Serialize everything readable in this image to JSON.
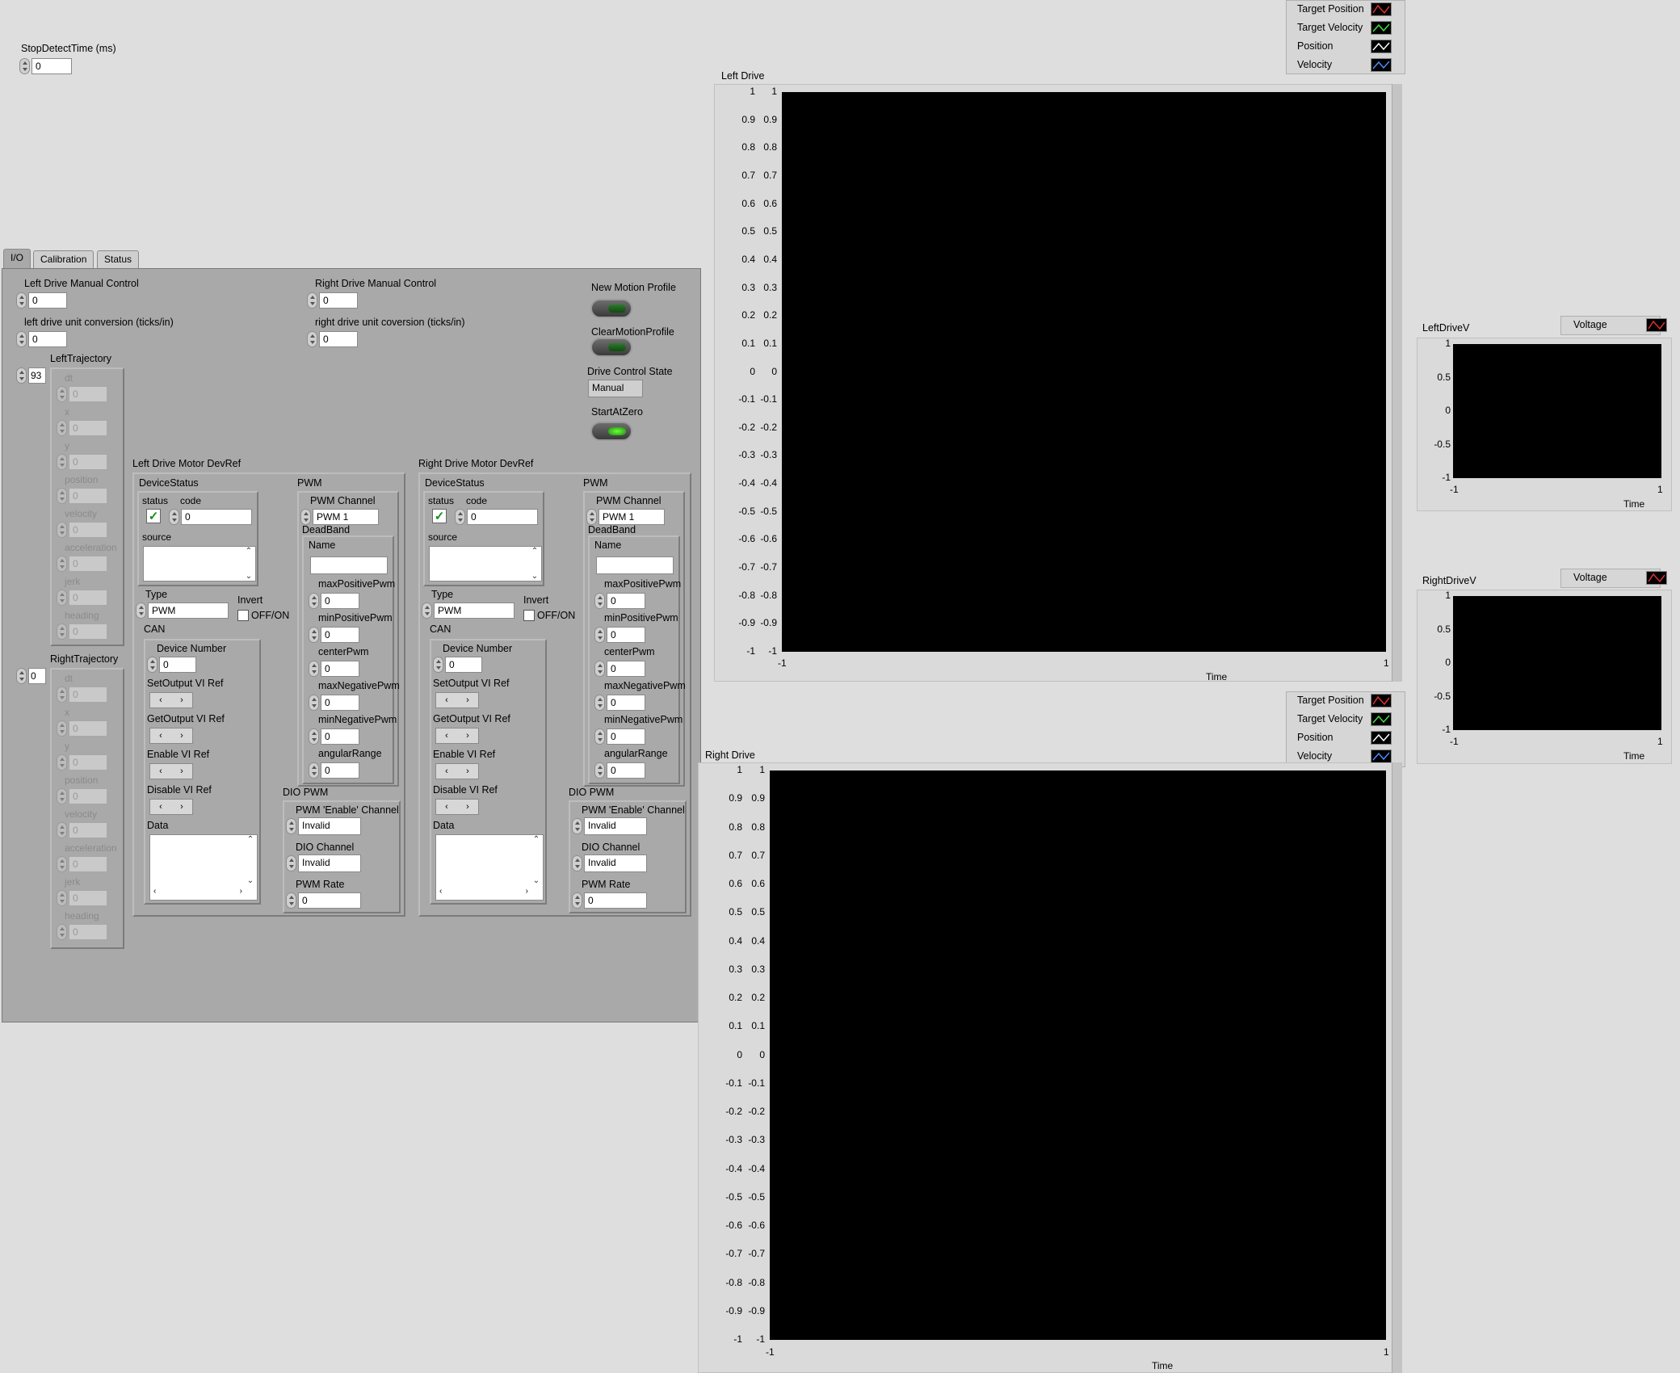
{
  "stop_detect": {
    "label": "StopDetectTime (ms)",
    "value": "0"
  },
  "tabs": [
    {
      "label": "I/O",
      "active": true
    },
    {
      "label": "Calibration",
      "active": false
    },
    {
      "label": "Status",
      "active": false
    }
  ],
  "io": {
    "left_manual": {
      "label": "Left Drive Manual Control",
      "value": "0"
    },
    "left_conv": {
      "label": "left drive unit conversion (ticks/in)",
      "value": "0"
    },
    "right_manual": {
      "label": "Right Drive Manual Control",
      "value": "0"
    },
    "right_conv": {
      "label": "right drive unit coversion (ticks/in)",
      "value": "0"
    },
    "new_motion_profile": "New Motion Profile",
    "clear_motion_profile": "ClearMotionProfile",
    "drive_control_state": {
      "label": "Drive Control State",
      "value": "Manual"
    },
    "start_at_zero": "StartAtZero",
    "left_traj": {
      "label": "LeftTrajectory",
      "index": "93",
      "fields": [
        {
          "label": "dt",
          "value": "0"
        },
        {
          "label": "x",
          "value": "0"
        },
        {
          "label": "y",
          "value": "0"
        },
        {
          "label": "position",
          "value": "0"
        },
        {
          "label": "velocity",
          "value": "0"
        },
        {
          "label": "acceleration",
          "value": "0"
        },
        {
          "label": "jerk",
          "value": "0"
        },
        {
          "label": "heading",
          "value": "0"
        }
      ]
    },
    "right_traj": {
      "label": "RightTrajectory",
      "index": "0",
      "fields": [
        {
          "label": "dt",
          "value": "0"
        },
        {
          "label": "x",
          "value": "0"
        },
        {
          "label": "y",
          "value": "0"
        },
        {
          "label": "position",
          "value": "0"
        },
        {
          "label": "velocity",
          "value": "0"
        },
        {
          "label": "acceleration",
          "value": "0"
        },
        {
          "label": "jerk",
          "value": "0"
        },
        {
          "label": "heading",
          "value": "0"
        }
      ]
    },
    "left_motor": {
      "label": "Left Drive Motor DevRef",
      "device_status": "DeviceStatus",
      "status": "status",
      "code": "code",
      "code_value": "0",
      "source": "source",
      "type_label": "Type",
      "type_value": "PWM",
      "invert": "Invert",
      "offon": "OFF/ON",
      "can": "CAN",
      "device_number": "Device Number",
      "device_number_value": "0",
      "set_output": "SetOutput VI Ref",
      "get_output": "GetOutput VI Ref",
      "enable_vi": "Enable VI Ref",
      "disable_vi": "Disable VI Ref",
      "data": "Data",
      "pwm": "PWM",
      "pwm_channel": "PWM Channel",
      "pwm_channel_value": "PWM 1",
      "deadband": "DeadBand",
      "name": "Name",
      "deadband_fields": [
        {
          "label": "maxPositivePwm",
          "value": "0"
        },
        {
          "label": "minPositivePwm",
          "value": "0"
        },
        {
          "label": "centerPwm",
          "value": "0"
        },
        {
          "label": "maxNegativePwm",
          "value": "0"
        },
        {
          "label": "minNegativePwm",
          "value": "0"
        },
        {
          "label": "angularRange",
          "value": "0"
        }
      ],
      "dio_pwm": "DIO PWM",
      "pwm_enable": "PWM 'Enable' Channel",
      "pwm_enable_value": "Invalid",
      "dio_channel": "DIO Channel",
      "dio_channel_value": "Invalid",
      "pwm_rate": "PWM Rate",
      "pwm_rate_value": "0"
    },
    "right_motor": {
      "label": "Right Drive Motor DevRef",
      "device_status": "DeviceStatus",
      "status": "status",
      "code": "code",
      "code_value": "0",
      "source": "source",
      "type_label": "Type",
      "type_value": "PWM",
      "invert": "Invert",
      "offon": "OFF/ON",
      "can": "CAN",
      "device_number": "Device Number",
      "device_number_value": "0",
      "set_output": "SetOutput VI Ref",
      "get_output": "GetOutput VI Ref",
      "enable_vi": "Enable VI Ref",
      "disable_vi": "Disable VI Ref",
      "data": "Data",
      "pwm": "PWM",
      "pwm_channel": "PWM Channel",
      "pwm_channel_value": "PWM 1",
      "deadband": "DeadBand",
      "name": "Name",
      "deadband_fields": [
        {
          "label": "maxPositivePwm",
          "value": "0"
        },
        {
          "label": "minPositivePwm",
          "value": "0"
        },
        {
          "label": "centerPwm",
          "value": "0"
        },
        {
          "label": "maxNegativePwm",
          "value": "0"
        },
        {
          "label": "minNegativePwm",
          "value": "0"
        },
        {
          "label": "angularRange",
          "value": "0"
        }
      ],
      "dio_pwm": "DIO PWM",
      "pwm_enable": "PWM 'Enable' Channel",
      "pwm_enable_value": "Invalid",
      "dio_channel": "DIO Channel",
      "dio_channel_value": "Invalid",
      "pwm_rate": "PWM Rate",
      "pwm_rate_value": "0"
    }
  },
  "legend_main": [
    {
      "label": "Target Position",
      "color": "#e03030"
    },
    {
      "label": "Target Velocity",
      "color": "#40e040"
    },
    {
      "label": "Position",
      "color": "#ffffff"
    },
    {
      "label": "Velocity",
      "color": "#4a8cff"
    }
  ],
  "legend_voltage": [
    {
      "label": "Voltage",
      "color": "#e03030"
    }
  ],
  "graphs": {
    "left": {
      "title": "Left Drive",
      "xlabel": "Time",
      "ticks": [
        "1",
        "0.9",
        "0.8",
        "0.7",
        "0.6",
        "0.5",
        "0.4",
        "0.3",
        "0.2",
        "0.1",
        "0",
        "-0.1",
        "-0.2",
        "-0.3",
        "-0.4",
        "-0.5",
        "-0.6",
        "-0.7",
        "-0.8",
        "-0.9",
        "-1"
      ],
      "xmin": "-1",
      "xmax": "1"
    },
    "right": {
      "title": "Right Drive",
      "xlabel": "Time",
      "ticks": [
        "1",
        "0.9",
        "0.8",
        "0.7",
        "0.6",
        "0.5",
        "0.4",
        "0.3",
        "0.2",
        "0.1",
        "0",
        "-0.1",
        "-0.2",
        "-0.3",
        "-0.4",
        "-0.5",
        "-0.6",
        "-0.7",
        "-0.8",
        "-0.9",
        "-1"
      ],
      "xmin": "-1",
      "xmax": "1"
    },
    "leftv": {
      "title": "LeftDriveV",
      "xlabel": "Time",
      "ticks": [
        "1",
        "0.5",
        "0",
        "-0.5",
        "-1"
      ],
      "xmin": "-1",
      "xmax": "1"
    },
    "rightv": {
      "title": "RightDriveV",
      "xlabel": "Time",
      "ticks": [
        "1",
        "0.5",
        "0",
        "-0.5",
        "-1"
      ],
      "xmin": "-1",
      "xmax": "1"
    }
  }
}
